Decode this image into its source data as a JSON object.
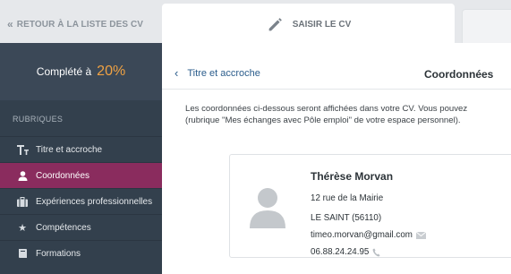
{
  "topbar": {
    "back_label": "RETOUR À LA LISTE DES CV",
    "active_tab_label": "SAISIR LE CV"
  },
  "sidebar": {
    "progress_label": "Complété à",
    "progress_value": "20%",
    "section_title": "RUBRIQUES",
    "items": [
      {
        "label": "Titre et accroche",
        "icon": "text-icon"
      },
      {
        "label": "Coordonnées",
        "icon": "user-icon",
        "active": true
      },
      {
        "label": "Expériences professionnelles",
        "icon": "briefcase-icon"
      },
      {
        "label": "Compétences",
        "icon": "star-icon"
      },
      {
        "label": "Formations",
        "icon": "book-icon"
      }
    ]
  },
  "main": {
    "prev_section_label": "Titre et accroche",
    "title": "Coordonnées",
    "intro_line1": "Les coordonnées ci-dessous seront affichées dans votre CV. Vous pouvez",
    "intro_line2": "(rubrique \"Mes échanges avec Pôle emploi\" de votre espace personnel).",
    "contact": {
      "name": "Thérèse Morvan",
      "street": "12 rue de la Mairie",
      "city": "LE SAINT (56110)",
      "email": "timeo.morvan@gmail.com",
      "phone": "06.88.24.24.95"
    }
  },
  "colors": {
    "sidebar_bg": "#33404d",
    "active_item": "#8a2c5e",
    "progress_accent": "#f0a243",
    "link": "#2b5d8c"
  }
}
